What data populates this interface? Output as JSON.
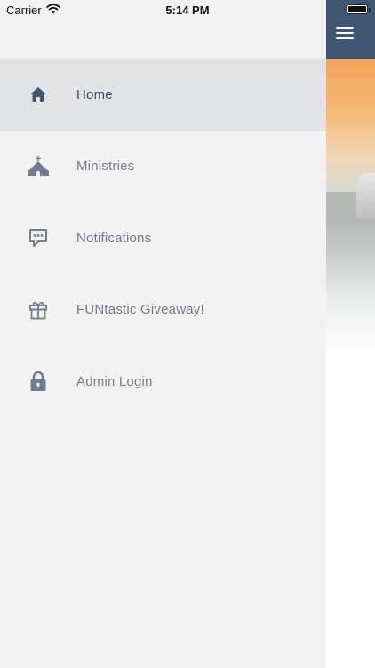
{
  "status_bar": {
    "carrier": "Carrier",
    "time": "5:14 PM"
  },
  "drawer": {
    "items": [
      {
        "label": "Home",
        "icon": "home-icon",
        "active": true
      },
      {
        "label": "Ministries",
        "icon": "church-icon",
        "active": false
      },
      {
        "label": "Notifications",
        "icon": "chat-bubble-icon",
        "active": false
      },
      {
        "label": "FUNtastic Giveaway!",
        "icon": "gift-icon",
        "active": false
      },
      {
        "label": "Admin Login",
        "icon": "lock-icon",
        "active": false
      }
    ]
  },
  "colors": {
    "drawer_bg": "#f2f2f2",
    "active_row": "#e2e3e5",
    "header_bar": "#3e5670",
    "label_text": "#6f7d93",
    "active_label_text": "#3c4e66"
  }
}
